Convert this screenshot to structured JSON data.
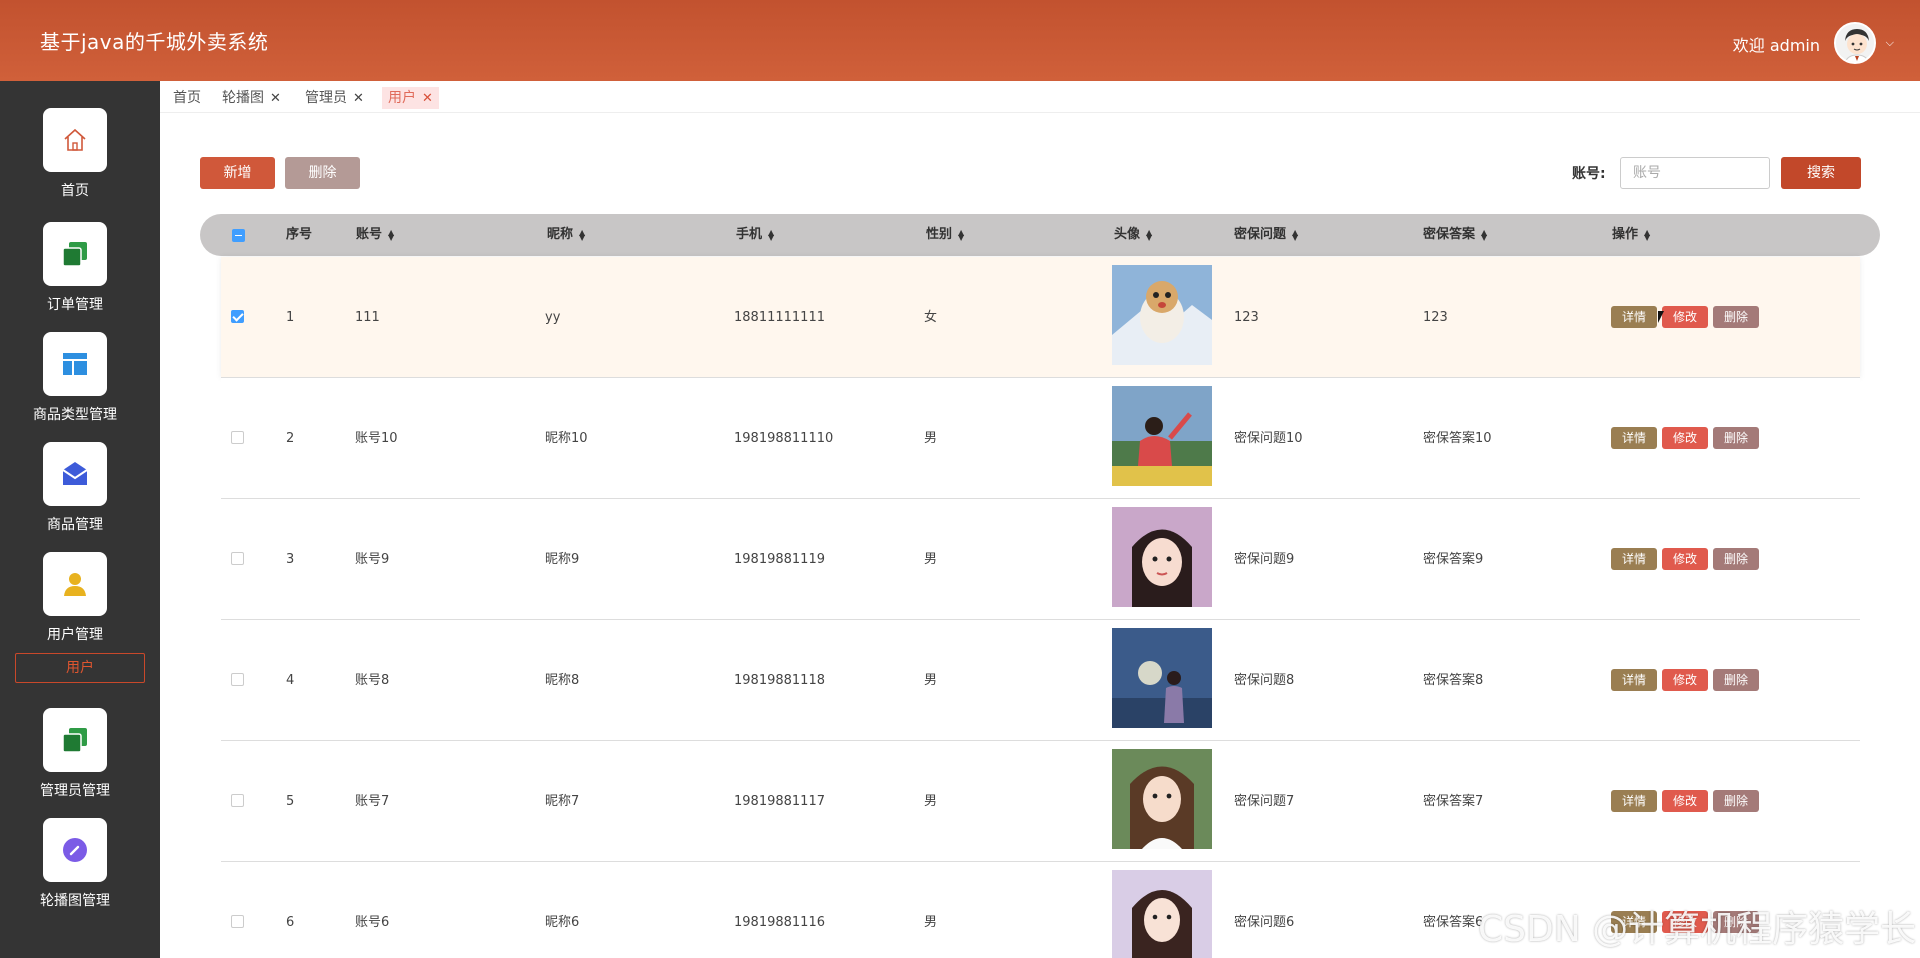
{
  "header": {
    "title": "基于java的千城外卖系统",
    "welcome": "欢迎 admin"
  },
  "sidebar": {
    "items": [
      {
        "label": "首页",
        "icon": "home-icon"
      },
      {
        "label": "订单管理",
        "icon": "copy-icon"
      },
      {
        "label": "商品类型管理",
        "icon": "layout-icon"
      },
      {
        "label": "商品管理",
        "icon": "mail-icon"
      },
      {
        "label": "用户管理",
        "icon": "user-icon"
      },
      {
        "label": "管理员管理",
        "icon": "copy-icon"
      },
      {
        "label": "轮播图管理",
        "icon": "edit-icon"
      }
    ],
    "sub_item": "用户"
  },
  "tabs": [
    {
      "label": "首页"
    },
    {
      "label": "轮播图"
    },
    {
      "label": "管理员"
    },
    {
      "label": "用户"
    }
  ],
  "toolbar": {
    "add_label": "新增",
    "delete_label": "删除",
    "search_label": "账号:",
    "search_placeholder": "账号",
    "search_button": "搜索"
  },
  "table": {
    "columns": [
      "序号",
      "账号",
      "昵称",
      "手机",
      "性别",
      "头像",
      "密保问题",
      "密保答案",
      "操作"
    ],
    "rows": [
      {
        "index": "1",
        "account": "111",
        "nickname": "yy",
        "phone": "18811111111",
        "gender": "女",
        "question": "123",
        "answer": "123"
      },
      {
        "index": "2",
        "account": "账号10",
        "nickname": "昵称10",
        "phone": "198198811110",
        "gender": "男",
        "question": "密保问题10",
        "answer": "密保答案10"
      },
      {
        "index": "3",
        "account": "账号9",
        "nickname": "昵称9",
        "phone": "19819881119",
        "gender": "男",
        "question": "密保问题9",
        "answer": "密保答案9"
      },
      {
        "index": "4",
        "account": "账号8",
        "nickname": "昵称8",
        "phone": "19819881118",
        "gender": "男",
        "question": "密保问题8",
        "answer": "密保答案8"
      },
      {
        "index": "5",
        "account": "账号7",
        "nickname": "昵称7",
        "phone": "19819881117",
        "gender": "男",
        "question": "密保问题7",
        "answer": "密保答案7"
      },
      {
        "index": "6",
        "account": "账号6",
        "nickname": "昵称6",
        "phone": "19819881116",
        "gender": "男",
        "question": "密保问题6",
        "answer": "密保答案6"
      }
    ],
    "actions": {
      "detail": "详情",
      "edit": "修改",
      "remove": "删除"
    }
  },
  "watermark": "CSDN @计算机程序猿学长",
  "colors": {
    "header": "#c9552f",
    "sidebar": "#343434",
    "accent": "#d0583a",
    "checkbox": "#409eff"
  }
}
